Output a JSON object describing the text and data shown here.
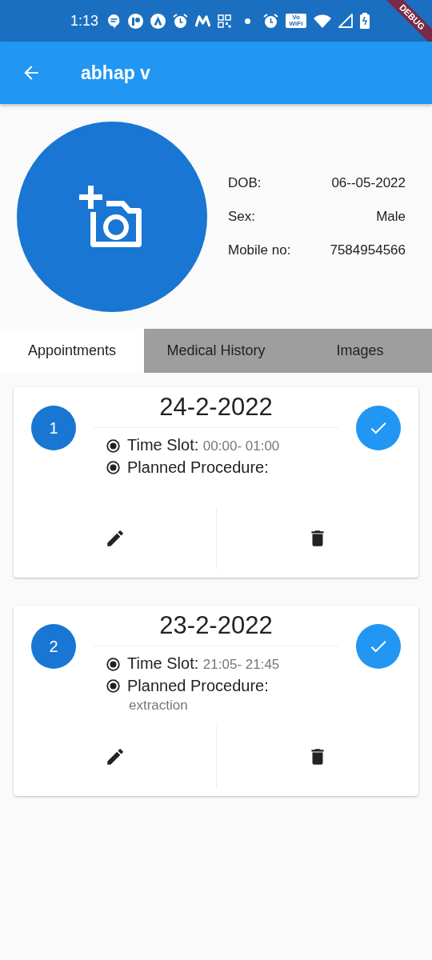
{
  "status_bar": {
    "time": "1:13",
    "network_label": "Vo WiFi",
    "banner": "DEBUG"
  },
  "app_bar": {
    "title": "abhap v"
  },
  "profile": {
    "fields": [
      {
        "label": "DOB:",
        "value": "06--05-2022"
      },
      {
        "label": "Sex:",
        "value": "Male"
      },
      {
        "label": "Mobile no:",
        "value": "7584954566"
      }
    ]
  },
  "tabs": [
    {
      "label": "Appointments",
      "selected": true
    },
    {
      "label": "Medical History",
      "selected": false
    },
    {
      "label": "Images",
      "selected": false
    }
  ],
  "appointments": [
    {
      "number": "1",
      "date": "24-2-2022",
      "time_slot_label": "Time Slot:",
      "time_slot": "00:00- 01:00",
      "procedure_label": "Planned Procedure:",
      "completed": true
    },
    {
      "number": "2",
      "date": "23-2-2022",
      "time_slot_label": "Time Slot:",
      "time_slot": "21:05- 21:45",
      "procedure_label": "Planned Procedure:",
      "procedure": "extraction",
      "completed": true
    }
  ]
}
